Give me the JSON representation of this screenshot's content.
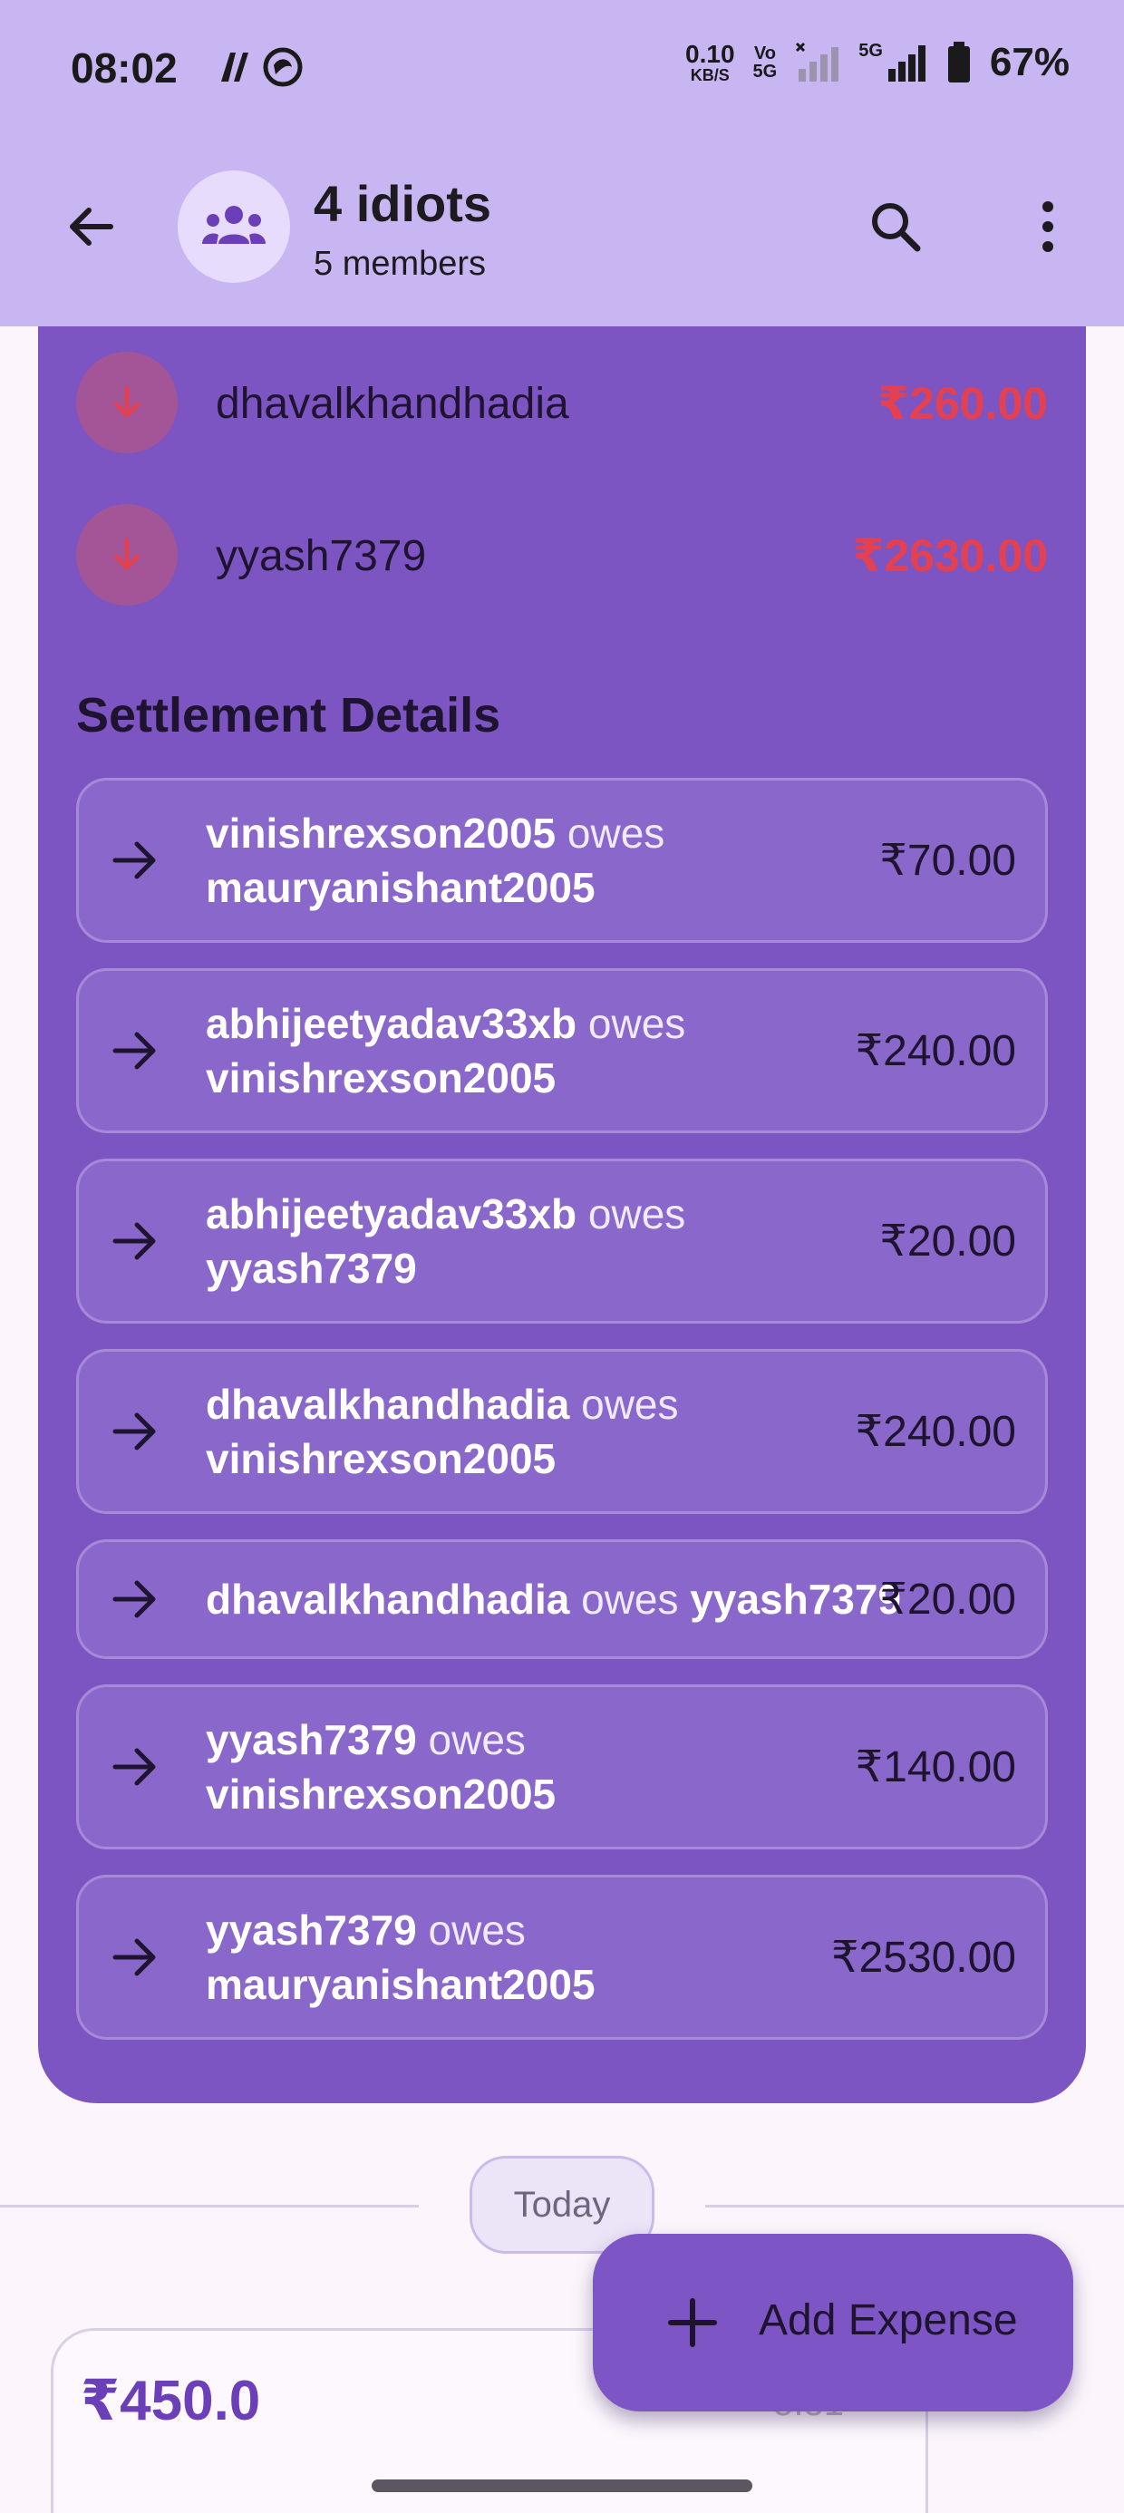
{
  "status_bar": {
    "time": "08:02",
    "net_speed_value": "0.10",
    "net_speed_unit": "KB/S",
    "volte_top": "Vo",
    "volte_bottom": "5G",
    "fiveg_label": "5G",
    "battery": "67%"
  },
  "header": {
    "title": "4 idiots",
    "subtitle": "5 members"
  },
  "balances": [
    {
      "name": "dhavalkhandhadia",
      "amount": "₹260.00"
    },
    {
      "name": "yyash7379",
      "amount": "₹2630.00"
    }
  ],
  "settlement": {
    "title": "Settlement Details",
    "items": [
      {
        "from": "vinishrexson2005",
        "owes": "owes",
        "to": "mauryanishant2005",
        "amount": "₹70.00"
      },
      {
        "from": "abhijeetyadav33xb",
        "owes": "owes",
        "to": "vinishrexson2005",
        "amount": "₹240.00"
      },
      {
        "from": "abhijeetyadav33xb",
        "owes": "owes",
        "to": "yyash7379",
        "amount": "₹20.00"
      },
      {
        "from": "dhavalkhandhadia",
        "owes": "owes",
        "to": "vinishrexson2005",
        "amount": "₹240.00"
      },
      {
        "from": "dhavalkhandhadia",
        "owes": "owes",
        "to": "yyash7379",
        "amount": "₹20.00"
      },
      {
        "from": "yyash7379",
        "owes": "owes",
        "to": "vinishrexson2005",
        "amount": "₹140.00"
      },
      {
        "from": "yyash7379",
        "owes": "owes",
        "to": "mauryanishant2005",
        "amount": "₹2530.00"
      }
    ]
  },
  "date_divider": "Today",
  "expense": {
    "amount": "₹450.0",
    "partial_text": "5:31"
  },
  "fab": {
    "label": "Add Expense"
  },
  "colors": {
    "appbar": "#c8b6f3",
    "card": "#7c55c3",
    "negative": "#e5404f",
    "accent": "#6a3fb8"
  }
}
